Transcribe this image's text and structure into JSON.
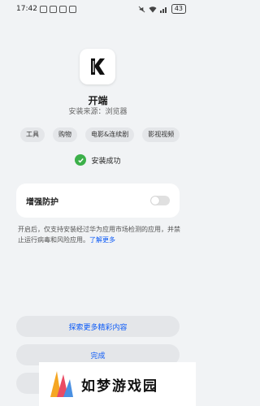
{
  "status": {
    "time": "17:42",
    "battery": "43"
  },
  "app": {
    "name": "开端",
    "install_source": "安装来源：浏览器"
  },
  "tags": [
    "工具",
    "购物",
    "电影&连续剧",
    "影视视频"
  ],
  "result": {
    "message": "安装成功",
    "color": "#3cb04a"
  },
  "protection": {
    "title": "增强防护",
    "description": "开启后，仅支持安装经过华为应用市场检测的应用，并禁止运行病毒和风险应用。",
    "learn_more": "了解更多"
  },
  "buttons": {
    "explore": "探索更多精彩内容",
    "done": "完成"
  },
  "watermark": {
    "text": "如梦游戏园"
  },
  "colors": {
    "accent": "#0a59f7",
    "background": "#f1f3f5"
  },
  "icons": {
    "app": "k-logo-icon",
    "success": "check-circle-icon"
  }
}
